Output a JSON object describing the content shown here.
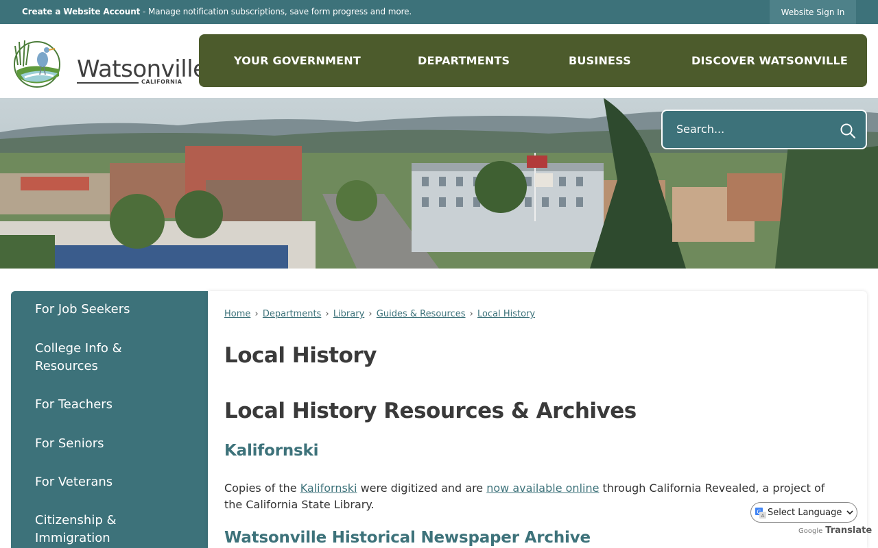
{
  "topbar": {
    "account_bold": "Create a Website Account",
    "account_rest": " - Manage notification subscriptions, save form progress and more.",
    "signin_label": "Website Sign In"
  },
  "logo": {
    "wordmark": "Watsonville",
    "sub": "CALIFORNIA"
  },
  "nav": {
    "items": [
      {
        "label": "YOUR GOVERNMENT"
      },
      {
        "label": "DEPARTMENTS"
      },
      {
        "label": "BUSINESS"
      },
      {
        "label": "DISCOVER WATSONVILLE"
      }
    ]
  },
  "search": {
    "placeholder": "Search..."
  },
  "sidebar": {
    "items": [
      {
        "label": "For Job Seekers"
      },
      {
        "label": "College Info & Resources"
      },
      {
        "label": "For Teachers"
      },
      {
        "label": "For Seniors"
      },
      {
        "label": "For Veterans"
      },
      {
        "label": "Citizenship & Immigration"
      }
    ]
  },
  "breadcrumb": {
    "items": [
      {
        "label": "Home"
      },
      {
        "label": "Departments"
      },
      {
        "label": "Library"
      },
      {
        "label": "Guides & Resources"
      },
      {
        "label": "Local History"
      }
    ],
    "separator": "›"
  },
  "content": {
    "page_title": "Local History",
    "section_title": "Local History Resources & Archives",
    "sub_title": "Kalifornski",
    "para_1": "Copies of the ",
    "para_link_1": "Kalifornski",
    "para_2": " were digitized and are ",
    "para_link_2": "now available online",
    "para_3": " through California Revealed, a project of the California State Library.",
    "sub_title_2": "Watsonville Historical Newspaper Archive"
  },
  "translate": {
    "select_label": "Select Language",
    "powered_google": "Google",
    "powered_translate": "Translate"
  },
  "colors": {
    "teal": "#3d727a",
    "olive": "#4c5b2c"
  }
}
